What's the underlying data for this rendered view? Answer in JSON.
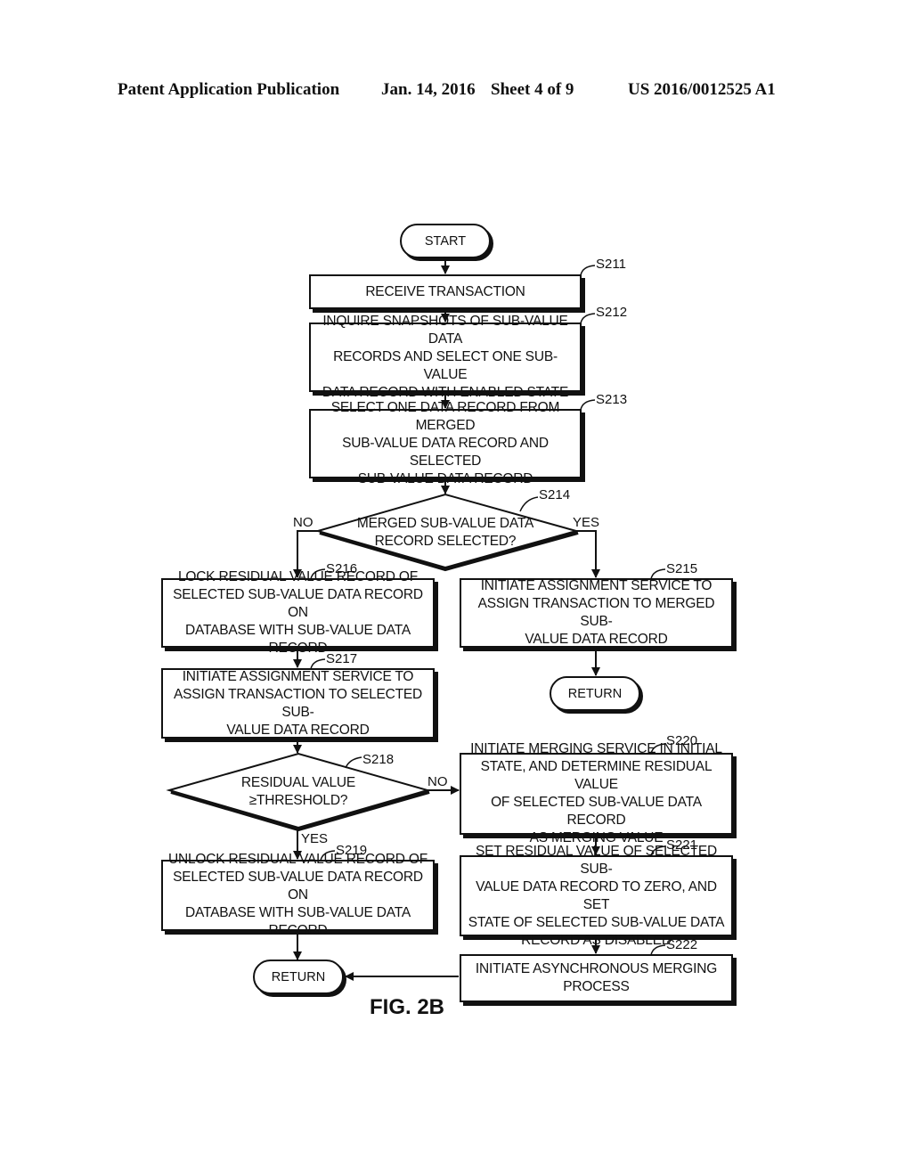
{
  "header": {
    "publication": "Patent Application Publication",
    "date": "Jan. 14, 2016",
    "sheet": "Sheet 4 of 9",
    "number": "US 2016/0012525 A1"
  },
  "figure_label": "FIG. 2B",
  "flowchart": {
    "start": "START",
    "return_right": "RETURN",
    "return_left": "RETURN",
    "steps": {
      "S211": {
        "id": "S211",
        "text": "RECEIVE TRANSACTION"
      },
      "S212": {
        "id": "S212",
        "text": "INQUIRE SNAPSHOTS OF SUB-VALUE DATA\nRECORDS AND SELECT ONE SUB-VALUE\nDATA RECORD WITH ENABLED STATE"
      },
      "S213": {
        "id": "S213",
        "text": "SELECT ONE DATA RECORD FROM MERGED\nSUB-VALUE DATA RECORD AND SELECTED\nSUB-VALUE DATA RECORD"
      },
      "S214": {
        "id": "S214",
        "text": "MERGED SUB-VALUE DATA\nRECORD SELECTED?",
        "no": "NO",
        "yes": "YES"
      },
      "S215": {
        "id": "S215",
        "text": "INITIATE ASSIGNMENT SERVICE TO\nASSIGN TRANSACTION TO  MERGED SUB-\nVALUE DATA RECORD"
      },
      "S216": {
        "id": "S216",
        "text": "LOCK RESIDUAL VALUE RECORD OF\nSELECTED SUB-VALUE DATA RECORD ON\nDATABASE WITH SUB-VALUE DATA RECORD"
      },
      "S217": {
        "id": "S217",
        "text": "INITIATE ASSIGNMENT SERVICE TO\nASSIGN TRANSACTION TO SELECTED SUB-\nVALUE DATA RECORD"
      },
      "S218": {
        "id": "S218",
        "text": "RESIDUAL VALUE\n≥THRESHOLD?",
        "no": "NO",
        "yes": "YES"
      },
      "S219": {
        "id": "S219",
        "text": "UNLOCK RESIDUAL VALUE RECORD OF\nSELECTED SUB-VALUE DATA RECORD ON\nDATABASE WITH SUB-VALUE DATA RECORD"
      },
      "S220": {
        "id": "S220",
        "text": "INITIATE MERGING SERVICE IN INITIAL\nSTATE, AND DETERMINE RESIDUAL VALUE\nOF SELECTED SUB-VALUE DATA RECORD\nAS MERGING VALUE"
      },
      "S221": {
        "id": "S221",
        "text": "SET RESIDUAL VALUE OF SELECTED SUB-\nVALUE DATA RECORD TO ZERO, AND SET\nSTATE OF SELECTED SUB-VALUE DATA\nRECORD AS DISABLED"
      },
      "S222": {
        "id": "S222",
        "text": "INITIATE ASYNCHRONOUS MERGING\nPROCESS"
      }
    }
  }
}
